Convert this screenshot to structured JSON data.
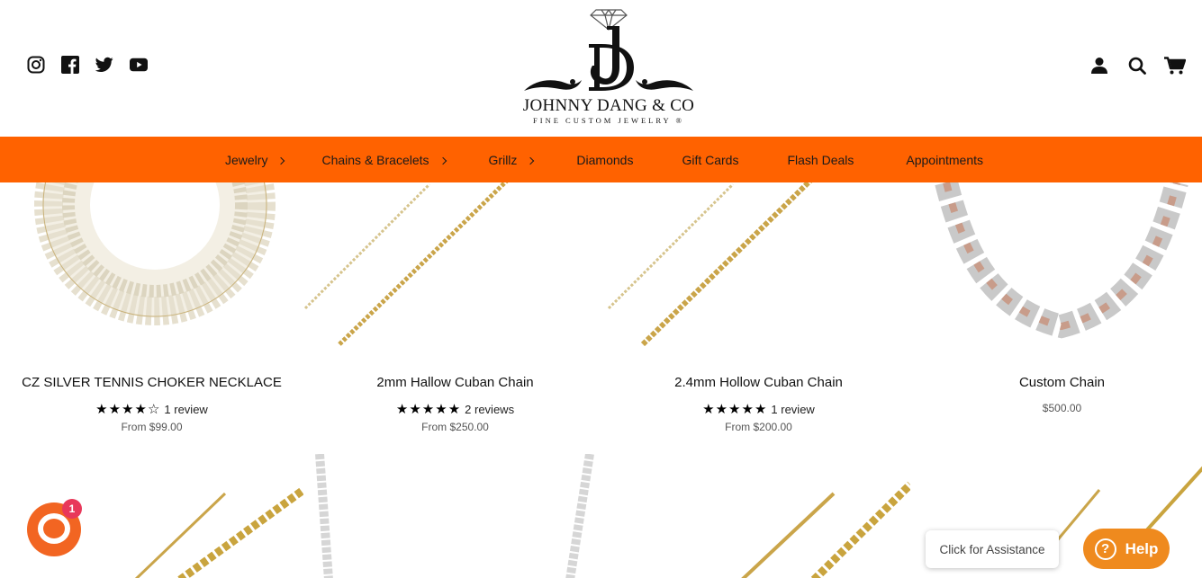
{
  "brand": {
    "name": "JOHNNY DANG & CO",
    "tagline": "FINE CUSTOM JEWELRY ®"
  },
  "social": [
    {
      "icon": "instagram-icon"
    },
    {
      "icon": "facebook-icon"
    },
    {
      "icon": "twitter-icon"
    },
    {
      "icon": "youtube-icon"
    }
  ],
  "header_icons": [
    {
      "icon": "account-icon"
    },
    {
      "icon": "search-icon"
    },
    {
      "icon": "cart-icon"
    }
  ],
  "nav": {
    "items": [
      {
        "label": "Jewelry",
        "has_submenu": true
      },
      {
        "label": "Chains & Bracelets",
        "has_submenu": true
      },
      {
        "label": "Grillz",
        "has_submenu": true
      },
      {
        "label": "Diamonds",
        "has_submenu": false
      },
      {
        "label": "Gift Cards",
        "has_submenu": false
      },
      {
        "label": "Flash Deals",
        "has_submenu": false
      },
      {
        "label": "Appointments",
        "has_submenu": false
      }
    ]
  },
  "products": [
    {
      "title": "CZ SILVER TENNIS CHOKER NECKLACE",
      "stars": "★★★★☆",
      "rating": 4,
      "reviews": "1 review",
      "price": "From $99.00"
    },
    {
      "title": "2mm Hallow Cuban Chain",
      "stars": "★★★★★",
      "rating": 5,
      "reviews": "2 reviews",
      "price": "From $250.00"
    },
    {
      "title": "2.4mm Hollow Cuban Chain",
      "stars": "★★★★★",
      "rating": 5,
      "reviews": "1 review",
      "price": "From $200.00"
    },
    {
      "title": "Custom Chain",
      "stars": "",
      "reviews": "",
      "price": "$500.00"
    }
  ],
  "chat": {
    "badge": "1",
    "assist": "Click for Assistance",
    "help": "Help",
    "help_icon": "?"
  },
  "colors": {
    "nav_bg": "#ff6200",
    "chat_orange": "#f26522",
    "help_orange": "#ef8a1e",
    "badge_red": "#e8385a",
    "gold": "#d4af37"
  }
}
